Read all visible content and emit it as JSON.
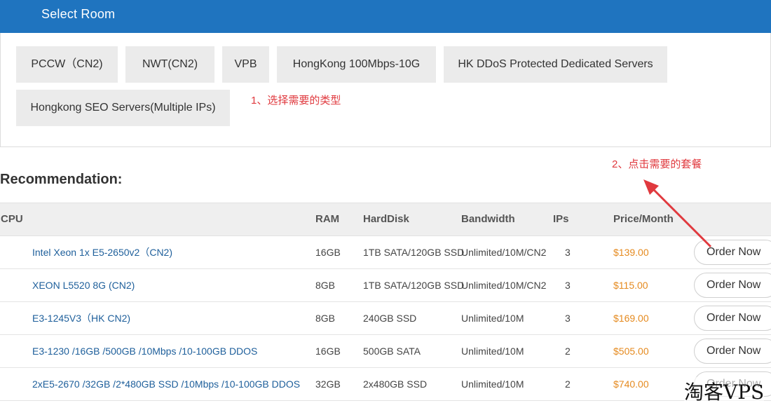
{
  "header": {
    "title": "Select Room"
  },
  "rooms": [
    {
      "label": "PCCW（CN2)"
    },
    {
      "label": "NWT(CN2)"
    },
    {
      "label": "VPB"
    },
    {
      "label": "HongKong 100Mbps-10G"
    },
    {
      "label": "HK DDoS Protected Dedicated Servers"
    },
    {
      "label": "Hongkong SEO Servers(Multiple IPs)"
    }
  ],
  "annotations": {
    "step1": "1、选择需要的类型",
    "step2": "2、点击需要的套餐"
  },
  "recommendation": {
    "title": "Recommendation:",
    "columns": {
      "cpu": "CPU",
      "ram": "RAM",
      "harddisk": "HardDisk",
      "bandwidth": "Bandwidth",
      "ips": "IPs",
      "price": "Price/Month"
    },
    "rows": [
      {
        "cpu": "Intel Xeon 1x E5-2650v2（CN2)",
        "ram": "16GB",
        "harddisk": "1TB SATA/120GB SSD",
        "bandwidth": "Unlimited/10M/CN2",
        "ips": "3",
        "price": "$139.00",
        "action": "Order Now"
      },
      {
        "cpu": "XEON L5520 8G (CN2)",
        "ram": "8GB",
        "harddisk": "1TB SATA/120GB SSD",
        "bandwidth": "Unlimited/10M/CN2",
        "ips": "3",
        "price": "$115.00",
        "action": "Order Now"
      },
      {
        "cpu": "E3-1245V3（HK CN2)",
        "ram": "8GB",
        "harddisk": "240GB SSD",
        "bandwidth": "Unlimited/10M",
        "ips": "3",
        "price": "$169.00",
        "action": "Order Now"
      },
      {
        "cpu": "E3-1230 /16GB /500GB /10Mbps /10-100GB DDOS",
        "ram": "16GB",
        "harddisk": "500GB SATA",
        "bandwidth": "Unlimited/10M",
        "ips": "2",
        "price": "$505.00",
        "action": "Order Now"
      },
      {
        "cpu": "2xE5-2670 /32GB /2*480GB SSD /10Mbps /10-100GB DDOS",
        "ram": "32GB",
        "harddisk": "2x480GB SSD",
        "bandwidth": "Unlimited/10M",
        "ips": "2",
        "price": "$740.00",
        "action": "Order Now"
      }
    ]
  },
  "watermark": "淘客VPS",
  "colors": {
    "header_bg": "#1f74bf",
    "annotation_red": "#e0393e",
    "price_orange": "#e58a1f",
    "cpu_link_blue": "#1e5f9b"
  }
}
